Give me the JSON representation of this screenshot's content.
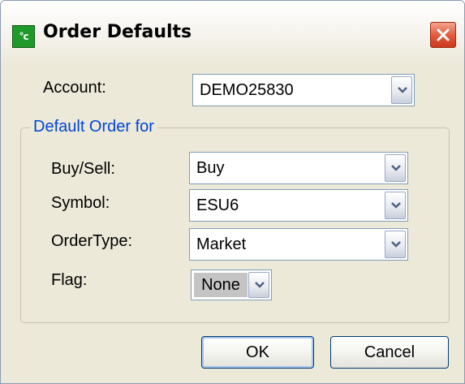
{
  "window": {
    "title": "Order Defaults",
    "icon_text": "°c",
    "icon": "app-icon",
    "close_icon": "close-icon"
  },
  "account": {
    "label": "Account:",
    "value": "DEMO25830"
  },
  "group": {
    "title": "Default Order for"
  },
  "fields": {
    "buy_sell": {
      "label": "Buy/Sell:",
      "value": "Buy"
    },
    "symbol": {
      "label": "Symbol:",
      "value": "ESU6"
    },
    "order_type": {
      "label": "OrderType:",
      "value": "Market"
    },
    "flag": {
      "label": "Flag:",
      "value": "None"
    }
  },
  "buttons": {
    "ok_label": "OK",
    "cancel_label": "Cancel"
  },
  "colors": {
    "dialog_background": "#ece9d8",
    "group_title": "#0046d5",
    "close_button": "#e0573b",
    "field_border": "#7f9db9"
  }
}
